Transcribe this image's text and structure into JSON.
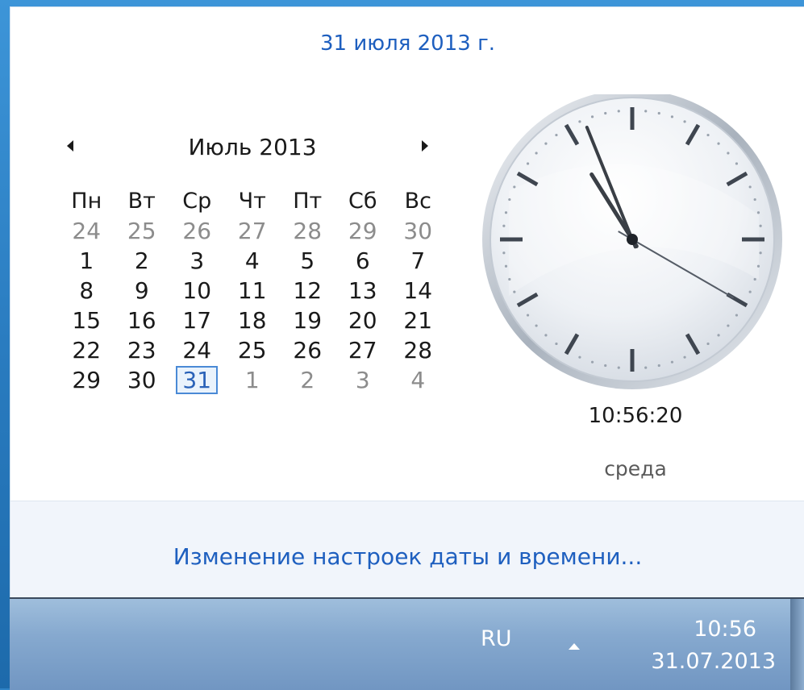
{
  "header": {
    "date_long": "31 июля 2013 г."
  },
  "calendar": {
    "month_title": "Июль 2013",
    "prev_icon": "triangle-left-icon",
    "next_icon": "triangle-right-icon",
    "weekdays": [
      "Пн",
      "Вт",
      "Ср",
      "Чт",
      "Пт",
      "Сб",
      "Вс"
    ],
    "weeks": [
      [
        "24",
        "25",
        "26",
        "27",
        "28",
        "29",
        "30"
      ],
      [
        "1",
        "2",
        "3",
        "4",
        "5",
        "6",
        "7"
      ],
      [
        "8",
        "9",
        "10",
        "11",
        "12",
        "13",
        "14"
      ],
      [
        "15",
        "16",
        "17",
        "18",
        "19",
        "20",
        "21"
      ],
      [
        "22",
        "23",
        "24",
        "25",
        "26",
        "27",
        "28"
      ],
      [
        "29",
        "30",
        "31",
        "1",
        "2",
        "3",
        "4"
      ]
    ],
    "other_month_cells": [
      [
        0,
        0
      ],
      [
        0,
        1
      ],
      [
        0,
        2
      ],
      [
        0,
        3
      ],
      [
        0,
        4
      ],
      [
        0,
        5
      ],
      [
        0,
        6
      ],
      [
        5,
        3
      ],
      [
        5,
        4
      ],
      [
        5,
        5
      ],
      [
        5,
        6
      ]
    ],
    "today_cell": [
      5,
      2
    ]
  },
  "clock": {
    "time": "10:56:20",
    "day": "среда",
    "hours": 10,
    "minutes": 56,
    "seconds": 20
  },
  "footer": {
    "settings_link": "Изменение настроек даты и времени..."
  },
  "taskbar": {
    "language": "RU",
    "tray_icon": "triangle-up-icon",
    "time": "10:56",
    "date": "31.07.2013"
  },
  "colors": {
    "accent": "#1e5fbf",
    "taskbar": "#86a9cf",
    "today_border": "#4a8ad6"
  }
}
